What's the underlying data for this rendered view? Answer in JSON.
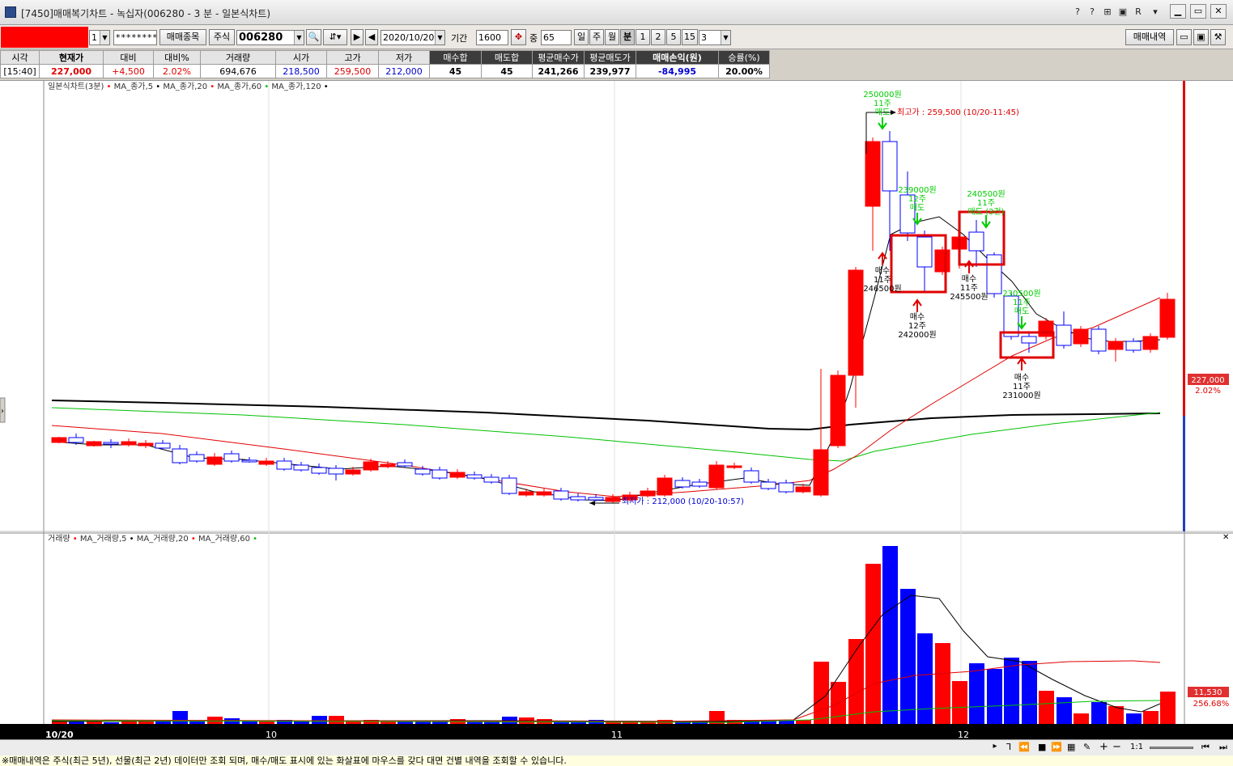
{
  "window": {
    "title": "[7450]매매복기차트 - 녹십자(006280 - 3 분 - 일본식차트)",
    "title_icons": [
      "?",
      "?",
      "⊞",
      "R",
      "▾"
    ]
  },
  "toolbar": {
    "account_value": "1",
    "password_mask": "********",
    "trade_item_button": "매매종목",
    "market_type": "주식",
    "stock_code": "006280",
    "date": "2020/10/20",
    "period_label": "기간",
    "period_value": "1600",
    "count_label": "중",
    "count_value": "65",
    "periods": [
      "일",
      "주",
      "월",
      "분",
      "1",
      "2",
      "5",
      "15"
    ],
    "minute_select": "3",
    "trade_history_button": "매매내역"
  },
  "summary": {
    "headers": [
      "시각",
      "현재가",
      "대비",
      "대비%",
      "거래량",
      "시가",
      "고가",
      "저가",
      "매수합",
      "매도합",
      "평균매수가",
      "평균매도가",
      "매매손익(원)",
      "승률(%)"
    ],
    "values": [
      "[15:40]",
      "227,000",
      "+4,500",
      "2.02%",
      "694,676",
      "218,500",
      "259,500",
      "212,000",
      "45",
      "45",
      "241,266",
      "239,977",
      "-84,995",
      "20.00%"
    ]
  },
  "chart": {
    "legend_price": "일본식차트(3분)",
    "ma_price": [
      "MA_종가,5",
      "MA_종가,20",
      "MA_종가,60",
      "MA_종가,120"
    ],
    "legend_volume": "거래량",
    "ma_volume": [
      "MA_거래량,5",
      "MA_거래량,20",
      "MA_거래량,60"
    ],
    "high_note": "최고가 : 259,500 (10/20-11:45)",
    "low_note": "최저가 : 212,000 (10/20-10:57)",
    "price_tag": "227,000",
    "pct_tag": "2.02%",
    "vol_tag": "11,530",
    "vol_pct_tag": "256.68%",
    "x_labels": [
      "10/20",
      "10",
      "11",
      "12"
    ],
    "sell_marks": [
      {
        "price": "250000원",
        "qty": "11주",
        "side": "매도"
      },
      {
        "price": "239000원",
        "qty": "12주",
        "side": "매도"
      },
      {
        "price": "240500원",
        "qty": "11주",
        "side": "매도 (3건)"
      },
      {
        "price": "230500원",
        "qty": "11주",
        "side": "매도"
      }
    ],
    "buy_marks": [
      {
        "side": "매수",
        "qty": "11주",
        "price": "246500원"
      },
      {
        "side": "매수",
        "qty": "12주",
        "price": "242000원"
      },
      {
        "side": "매수",
        "qty": "11주",
        "price": "245500원"
      },
      {
        "side": "매수",
        "qty": "11주",
        "price": "231000원"
      }
    ]
  },
  "nav": {
    "ratio": "1:1"
  },
  "status": "※매매내역은 주식(최근 5년), 선물(최근 2년) 데이터만 조회 되며, 매수/매도 표시에 있는 화살표에 마우스를 갖다 대면 건별 내역을 조회할 수 있습니다.",
  "colors": {
    "up": "#ff0000",
    "down": "#0000ff",
    "ma5": "#000000",
    "ma20": "#ff0000",
    "ma60": "#00c000",
    "buy_arrow": "#e00000",
    "sell_arrow": "#00cc00"
  }
}
